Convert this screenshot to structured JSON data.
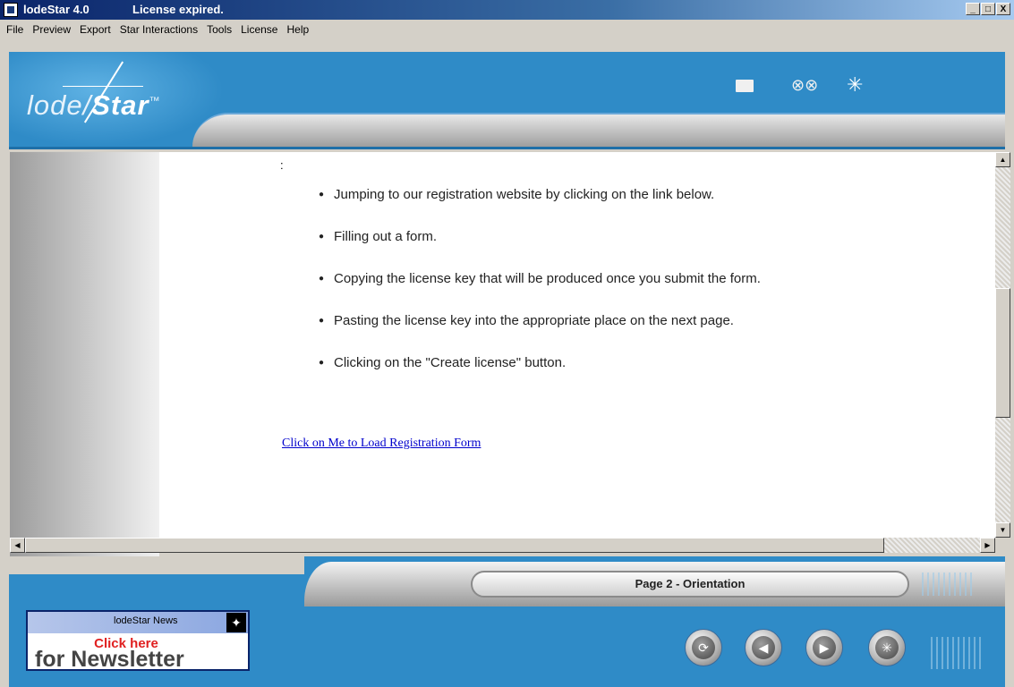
{
  "window": {
    "title": "lodeStar 4.0",
    "subtitle": "License expired.",
    "controls": [
      "_",
      "□",
      "X"
    ]
  },
  "menu": {
    "items": [
      "File",
      "Preview",
      "Export",
      "Star Interactions",
      "Tools",
      "License",
      "Help"
    ]
  },
  "header": {
    "logo_plain": "lode",
    "logo_bold": "Star",
    "logo_mark": "™",
    "icons": [
      "folder-icon",
      "film-projector-icon",
      "sparkle-star-icon"
    ]
  },
  "content": {
    "colon": ":",
    "bullets": [
      "Jumping to our registration website by clicking on the link below.",
      "Filling out a form.",
      "Copying the license key that will be produced once you submit the form.",
      "Pasting the license key into the appropriate place on the next page.",
      "Clicking on the \"Create license\" button."
    ],
    "link": "Click on Me to Load Registration Form"
  },
  "footer": {
    "page_label": "Page 2 - Orientation",
    "news_title": "lodeStar News",
    "news_click": "Click here",
    "news_for": "for Newsletter",
    "nav_buttons": [
      "refresh-icon",
      "back-arrow-icon",
      "forward-arrow-icon",
      "star-icon"
    ]
  },
  "colors": {
    "accent_blue": "#2f8bc7",
    "link_blue": "#0000cc",
    "titlebar": "#0a246a"
  }
}
